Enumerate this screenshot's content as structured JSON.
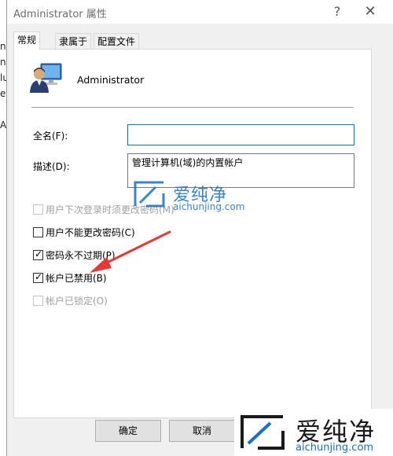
{
  "behind_window": {
    "fragments": [
      "ni",
      "nl",
      "lu",
      "es",
      "A"
    ]
  },
  "window": {
    "title": "Administrator 属性",
    "help_glyph": "?",
    "close_glyph": "✕"
  },
  "tabs": [
    {
      "label": "常规",
      "active": true
    },
    {
      "label": "隶属于",
      "active": false
    },
    {
      "label": "配置文件",
      "active": false
    }
  ],
  "user": {
    "name": "Administrator",
    "icon": "user-account-icon"
  },
  "fields": {
    "fullname_label": "全名(F):",
    "fullname_value": "",
    "description_label": "描述(D):",
    "description_value": "管理计算机(域)的内置帐户"
  },
  "checkboxes": [
    {
      "label": "用户下次登录时须更改密码(M)",
      "checked": false,
      "enabled": false
    },
    {
      "label": "用户不能更改密码(C)",
      "checked": false,
      "enabled": true
    },
    {
      "label": "密码永不过期(P)",
      "checked": true,
      "enabled": true
    },
    {
      "label": "帐户已禁用(B)",
      "checked": true,
      "enabled": true
    },
    {
      "label": "帐户已锁定(O)",
      "checked": false,
      "enabled": false
    }
  ],
  "buttons": {
    "ok": "确定",
    "cancel": "取消"
  },
  "watermark": {
    "brand": "爱纯净",
    "url": "aichunjing.com"
  },
  "colors": {
    "accent": "#0078d7",
    "arrow": "#e53935",
    "watermark": "#1a6fc0"
  }
}
